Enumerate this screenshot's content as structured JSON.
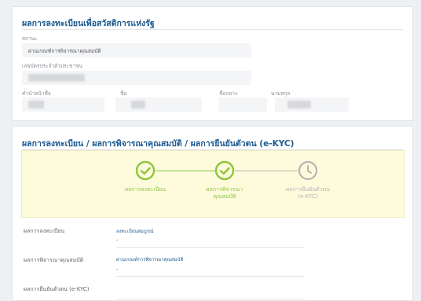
{
  "registration_card": {
    "title": "ผลการลงทะเบียนเพื่อสวัสดิการแห่งรัฐ",
    "status_label": "สถานะ",
    "status_value": "ผ่านเกณฑ์การพิจารณาคุณสมบัติ",
    "id_label": "เลขบัตรประจำตัวประชาชน",
    "prefix_label": "คำนำหน้าชื่อ",
    "firstname_label": "ชื่อ",
    "middlename_label": "ชื่อกลาง",
    "lastname_label": "นามสกุล"
  },
  "results_card": {
    "title": "ผลการลงทะเบียน / ผลการพิจารณาคุณสมบัติ / ผลการยืนยันตัวตน (e-KYC)",
    "steps": [
      {
        "label_line1": "ผลการลงทะเบียน",
        "label_line2": "",
        "state": "done"
      },
      {
        "label_line1": "ผลการพิจารณา",
        "label_line2": "คุณสมบัติ",
        "state": "done"
      },
      {
        "label_line1": "ผลการยืนยันตัวตน",
        "label_line2": "(e-KYC)",
        "state": "pending"
      }
    ],
    "rows": [
      {
        "label": "ผลการลงทะเบียน",
        "value": "ลงทะเบียนสมบูรณ์",
        "detail": "-"
      },
      {
        "label": "ผลการพิจารณาคุณสมบัติ",
        "value": "ผ่านเกณฑ์การพิจารณาคุณสมบัติ",
        "detail": "-"
      },
      {
        "label": "ผลการยืนยันตัวตน (e-KYC)",
        "value": "",
        "detail": ""
      }
    ]
  },
  "colors": {
    "title_blue": "#1c5a8f",
    "success_green": "#8cc63e",
    "pending_gray": "#b5b5b5",
    "steps_bg": "#fdfbdc"
  }
}
